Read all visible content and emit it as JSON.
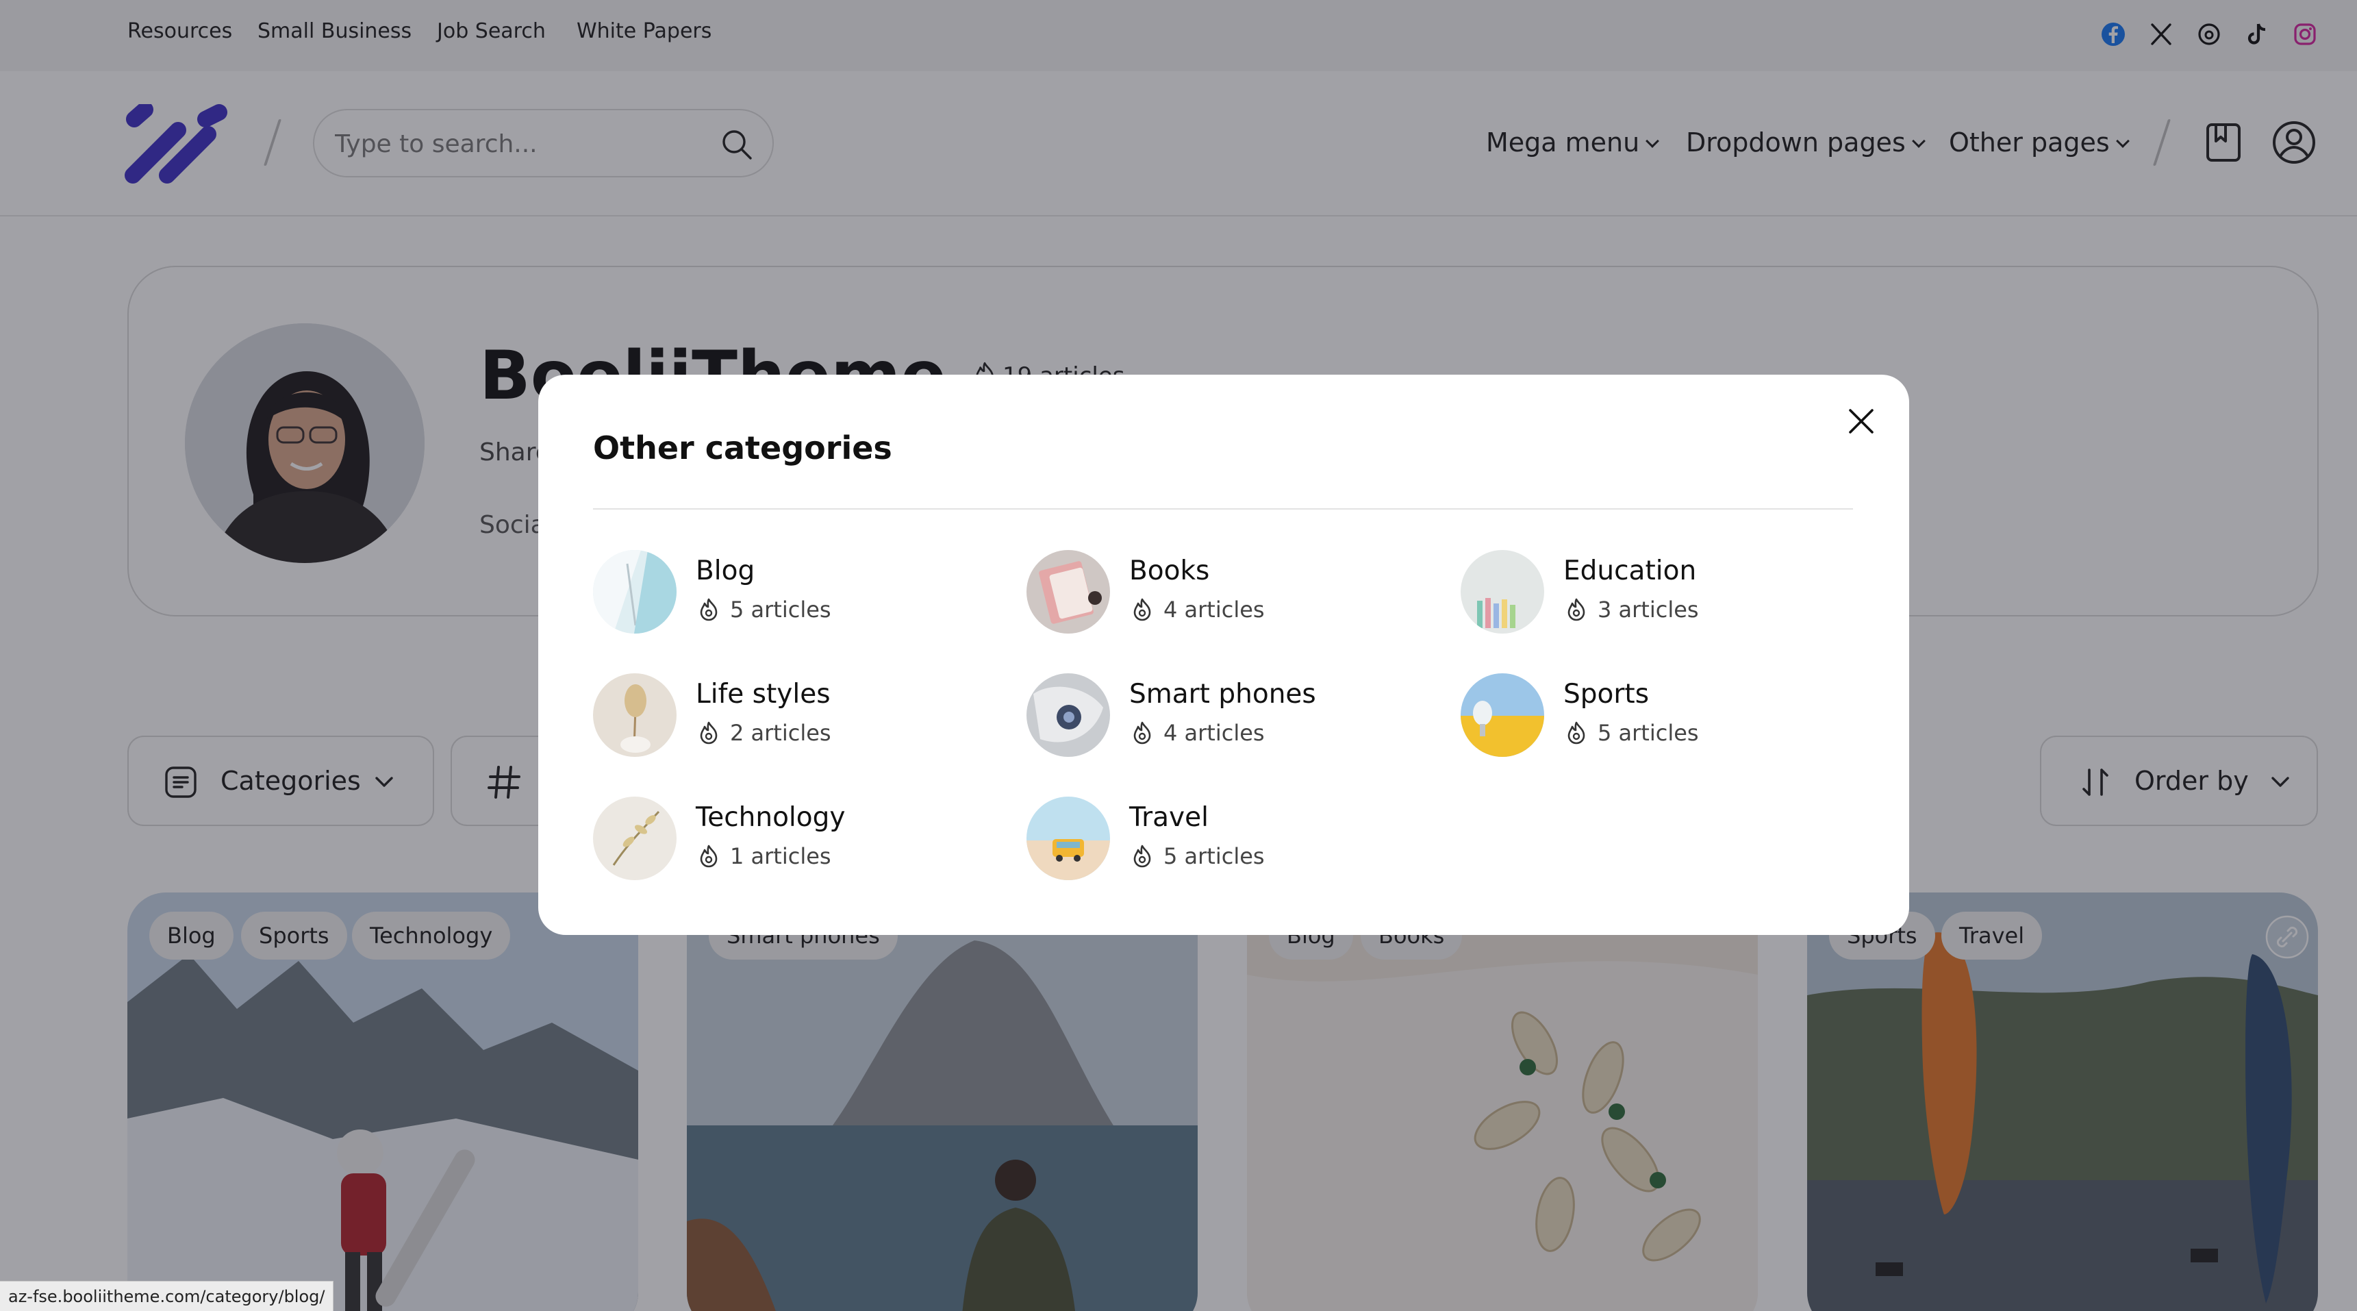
{
  "topbar": {
    "links": [
      "Resources",
      "Small Business",
      "Job Search",
      "White Papers"
    ],
    "social": [
      "facebook-icon",
      "x-icon",
      "threads-icon",
      "tiktok-icon",
      "instagram-icon"
    ]
  },
  "header": {
    "search_placeholder": "Type to search...",
    "nav": [
      "Mega menu",
      "Dropdown pages",
      "Other pages"
    ],
    "icons": [
      "bookmark-icon",
      "user-icon"
    ]
  },
  "profile": {
    "name": "BooliiTheme",
    "articles": "19 articles",
    "share_text": "Share",
    "social_text": "Social"
  },
  "toolbar": {
    "categories_label": "Categories",
    "order_label": "Order by"
  },
  "cards": [
    {
      "tags": [
        "Blog",
        "Sports",
        "Technology"
      ]
    },
    {
      "tags": [
        "Smart phones"
      ]
    },
    {
      "tags": [
        "Blog",
        "Books"
      ]
    },
    {
      "tags": [
        "Sports",
        "Travel"
      ]
    }
  ],
  "modal": {
    "title": "Other categories",
    "categories": [
      {
        "name": "Blog",
        "count": "5 articles"
      },
      {
        "name": "Books",
        "count": "4 articles"
      },
      {
        "name": "Education",
        "count": "3 articles"
      },
      {
        "name": "Life styles",
        "count": "2 articles"
      },
      {
        "name": "Smart phones",
        "count": "4 articles"
      },
      {
        "name": "Sports",
        "count": "5 articles"
      },
      {
        "name": "Technology",
        "count": "1 articles"
      },
      {
        "name": "Travel",
        "count": "5 articles"
      }
    ]
  },
  "status_url": "az-fse.booliitheme.com/category/blog/",
  "colors": {
    "brand": "#3d2fc4",
    "facebook": "#1877f2",
    "instagram": "#d6249f"
  }
}
